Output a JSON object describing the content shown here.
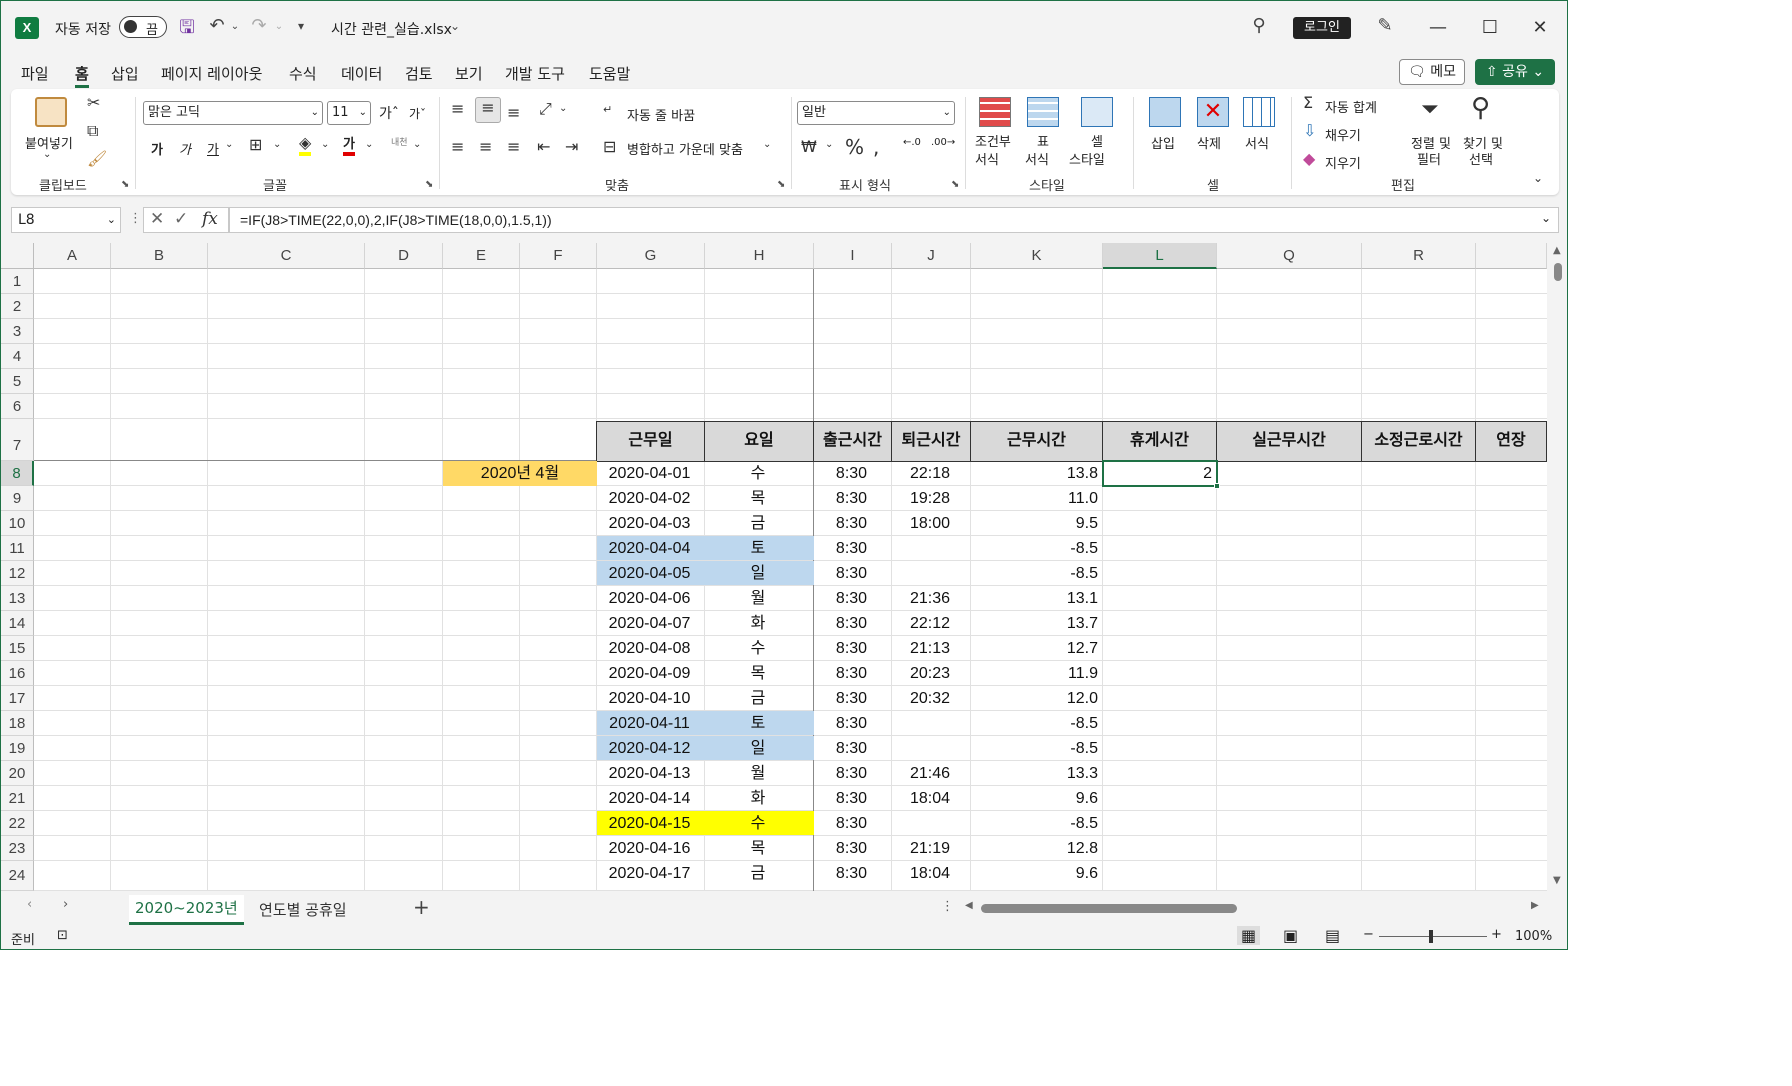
{
  "titlebar": {
    "autosave_label": "자동 저장",
    "toggle_state": "끔",
    "filename": "시간 관련_실습.xlsx",
    "login_label": "로그인"
  },
  "menu": {
    "tabs": [
      "파일",
      "홈",
      "삽입",
      "페이지 레이아웃",
      "수식",
      "데이터",
      "검토",
      "보기",
      "개발 도구",
      "도움말"
    ],
    "active_tab": "홈",
    "memo_label": "메모",
    "share_label": "공유"
  },
  "ribbon": {
    "clipboard": {
      "paste_label": "붙여넣기",
      "group_label": "클립보드"
    },
    "font": {
      "font_name": "맑은 고딕",
      "font_size": "11",
      "group_label": "글꼴",
      "bold": "가",
      "italic": "가",
      "underline": "가"
    },
    "alignment": {
      "wrap_label": "자동 줄 바꿈",
      "merge_label": "병합하고 가운데 맞춤",
      "group_label": "맞춤"
    },
    "number": {
      "format": "일반",
      "group_label": "표시 형식"
    },
    "styles": {
      "conditional_label1": "조건부",
      "conditional_label2": "서식",
      "table_label1": "표",
      "table_label2": "서식",
      "cell_label1": "셀",
      "cell_label2": "스타일",
      "group_label": "스타일"
    },
    "cells": {
      "insert_label": "삽입",
      "delete_label": "삭제",
      "format_label": "서식",
      "group_label": "셀"
    },
    "editing": {
      "autosum_label": "자동 합계",
      "fill_label": "채우기",
      "clear_label": "지우기",
      "sort_label1": "정렬 및",
      "sort_label2": "필터",
      "find_label1": "찾기 및",
      "find_label2": "선택",
      "group_label": "편집"
    }
  },
  "formula_bar": {
    "name_box": "L8",
    "fx": "fx",
    "formula": "=IF(J8>TIME(22,0,0),2,IF(J8>TIME(18,0,0),1.5,1))"
  },
  "columns": [
    "A",
    "B",
    "C",
    "D",
    "E",
    "F",
    "G",
    "H",
    "I",
    "J",
    "K",
    "L",
    "Q",
    "R",
    ""
  ],
  "selected_column": "L",
  "rows": [
    "1",
    "2",
    "3",
    "4",
    "5",
    "6",
    "7",
    "8",
    "9",
    "10",
    "11",
    "12",
    "13",
    "14",
    "15",
    "16",
    "17",
    "18",
    "19",
    "20",
    "21",
    "22",
    "23",
    "24"
  ],
  "selected_row": "8",
  "table_headers": [
    "근무일",
    "요일",
    "출근시간",
    "퇴근시간",
    "근무시간",
    "휴게시간",
    "실근무시간",
    "소정근로시간",
    "연장"
  ],
  "month_label": "2020년 4월",
  "table_rows": [
    {
      "date": "2020-04-01",
      "day": "수",
      "in": "8:30",
      "out": "22:18",
      "hours": "13.8",
      "break": "2",
      "hl": ""
    },
    {
      "date": "2020-04-02",
      "day": "목",
      "in": "8:30",
      "out": "19:28",
      "hours": "11.0",
      "break": "",
      "hl": ""
    },
    {
      "date": "2020-04-03",
      "day": "금",
      "in": "8:30",
      "out": "18:00",
      "hours": "9.5",
      "break": "",
      "hl": ""
    },
    {
      "date": "2020-04-04",
      "day": "토",
      "in": "8:30",
      "out": "",
      "hours": "-8.5",
      "break": "",
      "hl": "blue"
    },
    {
      "date": "2020-04-05",
      "day": "일",
      "in": "8:30",
      "out": "",
      "hours": "-8.5",
      "break": "",
      "hl": "blue"
    },
    {
      "date": "2020-04-06",
      "day": "월",
      "in": "8:30",
      "out": "21:36",
      "hours": "13.1",
      "break": "",
      "hl": ""
    },
    {
      "date": "2020-04-07",
      "day": "화",
      "in": "8:30",
      "out": "22:12",
      "hours": "13.7",
      "break": "",
      "hl": ""
    },
    {
      "date": "2020-04-08",
      "day": "수",
      "in": "8:30",
      "out": "21:13",
      "hours": "12.7",
      "break": "",
      "hl": ""
    },
    {
      "date": "2020-04-09",
      "day": "목",
      "in": "8:30",
      "out": "20:23",
      "hours": "11.9",
      "break": "",
      "hl": ""
    },
    {
      "date": "2020-04-10",
      "day": "금",
      "in": "8:30",
      "out": "20:32",
      "hours": "12.0",
      "break": "",
      "hl": ""
    },
    {
      "date": "2020-04-11",
      "day": "토",
      "in": "8:30",
      "out": "",
      "hours": "-8.5",
      "break": "",
      "hl": "blue"
    },
    {
      "date": "2020-04-12",
      "day": "일",
      "in": "8:30",
      "out": "",
      "hours": "-8.5",
      "break": "",
      "hl": "blue"
    },
    {
      "date": "2020-04-13",
      "day": "월",
      "in": "8:30",
      "out": "21:46",
      "hours": "13.3",
      "break": "",
      "hl": ""
    },
    {
      "date": "2020-04-14",
      "day": "화",
      "in": "8:30",
      "out": "18:04",
      "hours": "9.6",
      "break": "",
      "hl": ""
    },
    {
      "date": "2020-04-15",
      "day": "수",
      "in": "8:30",
      "out": "",
      "hours": "-8.5",
      "break": "",
      "hl": "yellow"
    },
    {
      "date": "2020-04-16",
      "day": "목",
      "in": "8:30",
      "out": "21:19",
      "hours": "12.8",
      "break": "",
      "hl": ""
    },
    {
      "date": "2020-04-17",
      "day": "금",
      "in": "8:30",
      "out": "18:04",
      "hours": "9.6",
      "break": "",
      "hl": ""
    }
  ],
  "sheets": [
    "2020~2023년",
    "연도별 공휴일"
  ],
  "active_sheet": "2020~2023년",
  "status": {
    "ready": "준비",
    "zoom": "100%"
  },
  "colors": {
    "accent": "#1e7145",
    "month_fill": "#ffd966",
    "weekend_fill": "#bdd7ee",
    "holiday_fill": "#ffff00",
    "header_fill": "#d9d9d9"
  }
}
